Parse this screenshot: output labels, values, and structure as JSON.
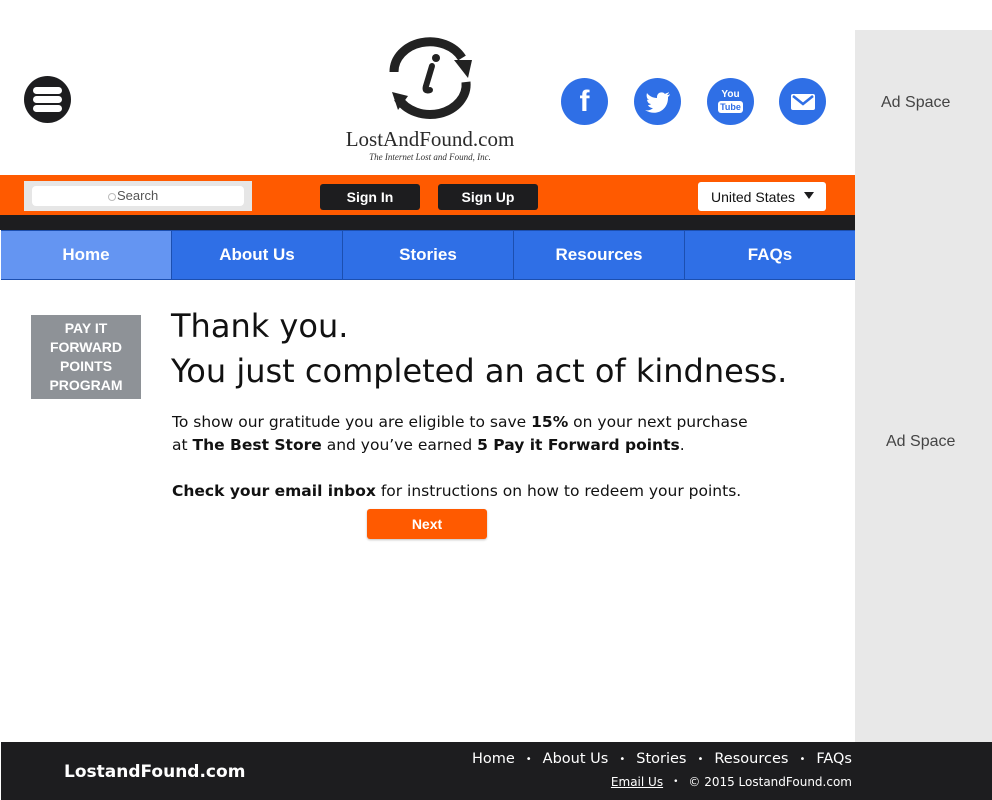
{
  "header": {
    "logo": {
      "name": "LostAndFound.com",
      "tagline": "The Internet Lost and Found, Inc."
    },
    "social": [
      {
        "icon": "facebook-icon",
        "glyph": "f"
      },
      {
        "icon": "twitter-icon"
      },
      {
        "icon": "youtube-icon",
        "text_top": "You",
        "text_bottom": "Tube"
      },
      {
        "icon": "email-icon"
      }
    ]
  },
  "toolbar": {
    "search_placeholder": "Search",
    "sign_in": "Sign In",
    "sign_up": "Sign Up",
    "country": "United States"
  },
  "nav": {
    "items": [
      "Home",
      "About Us",
      "Stories",
      "Resources",
      "FAQs"
    ],
    "active": "Home"
  },
  "ads": {
    "top": "Ad Space",
    "middle": "Ad Space"
  },
  "sidebar": {
    "badge_lines": [
      "PAY IT",
      "FORWARD",
      "POINTS",
      "PROGRAM"
    ]
  },
  "main": {
    "heading_line1": "Thank you.",
    "heading_line2": "You just completed an act of kindness.",
    "p1_a": "To show our gratitude you are eligible to save ",
    "p1_b": "15%",
    "p1_c": " on your next purchase",
    "p2_a": "at ",
    "p2_b": "The Best Store",
    "p2_c": " and you’ve earned ",
    "p2_d": "5 Pay it Forward points",
    "p2_e": ".",
    "p3_a": "Check your email inbox",
    "p3_b": " for instructions on how to redeem your points.",
    "next_label": "Next"
  },
  "footer": {
    "brand": "LostandFound.com",
    "links": [
      "Home",
      "About Us",
      "Stories",
      "Resources",
      "FAQs"
    ],
    "email_label": "Email Us",
    "copyright": "© 2015 LostandFound.com"
  },
  "colors": {
    "orange": "#ff5a00",
    "blue": "#2f6fe6",
    "nav_active": "#6495f2",
    "dark": "#1d1d1f",
    "badge_gray": "#8e9297"
  }
}
